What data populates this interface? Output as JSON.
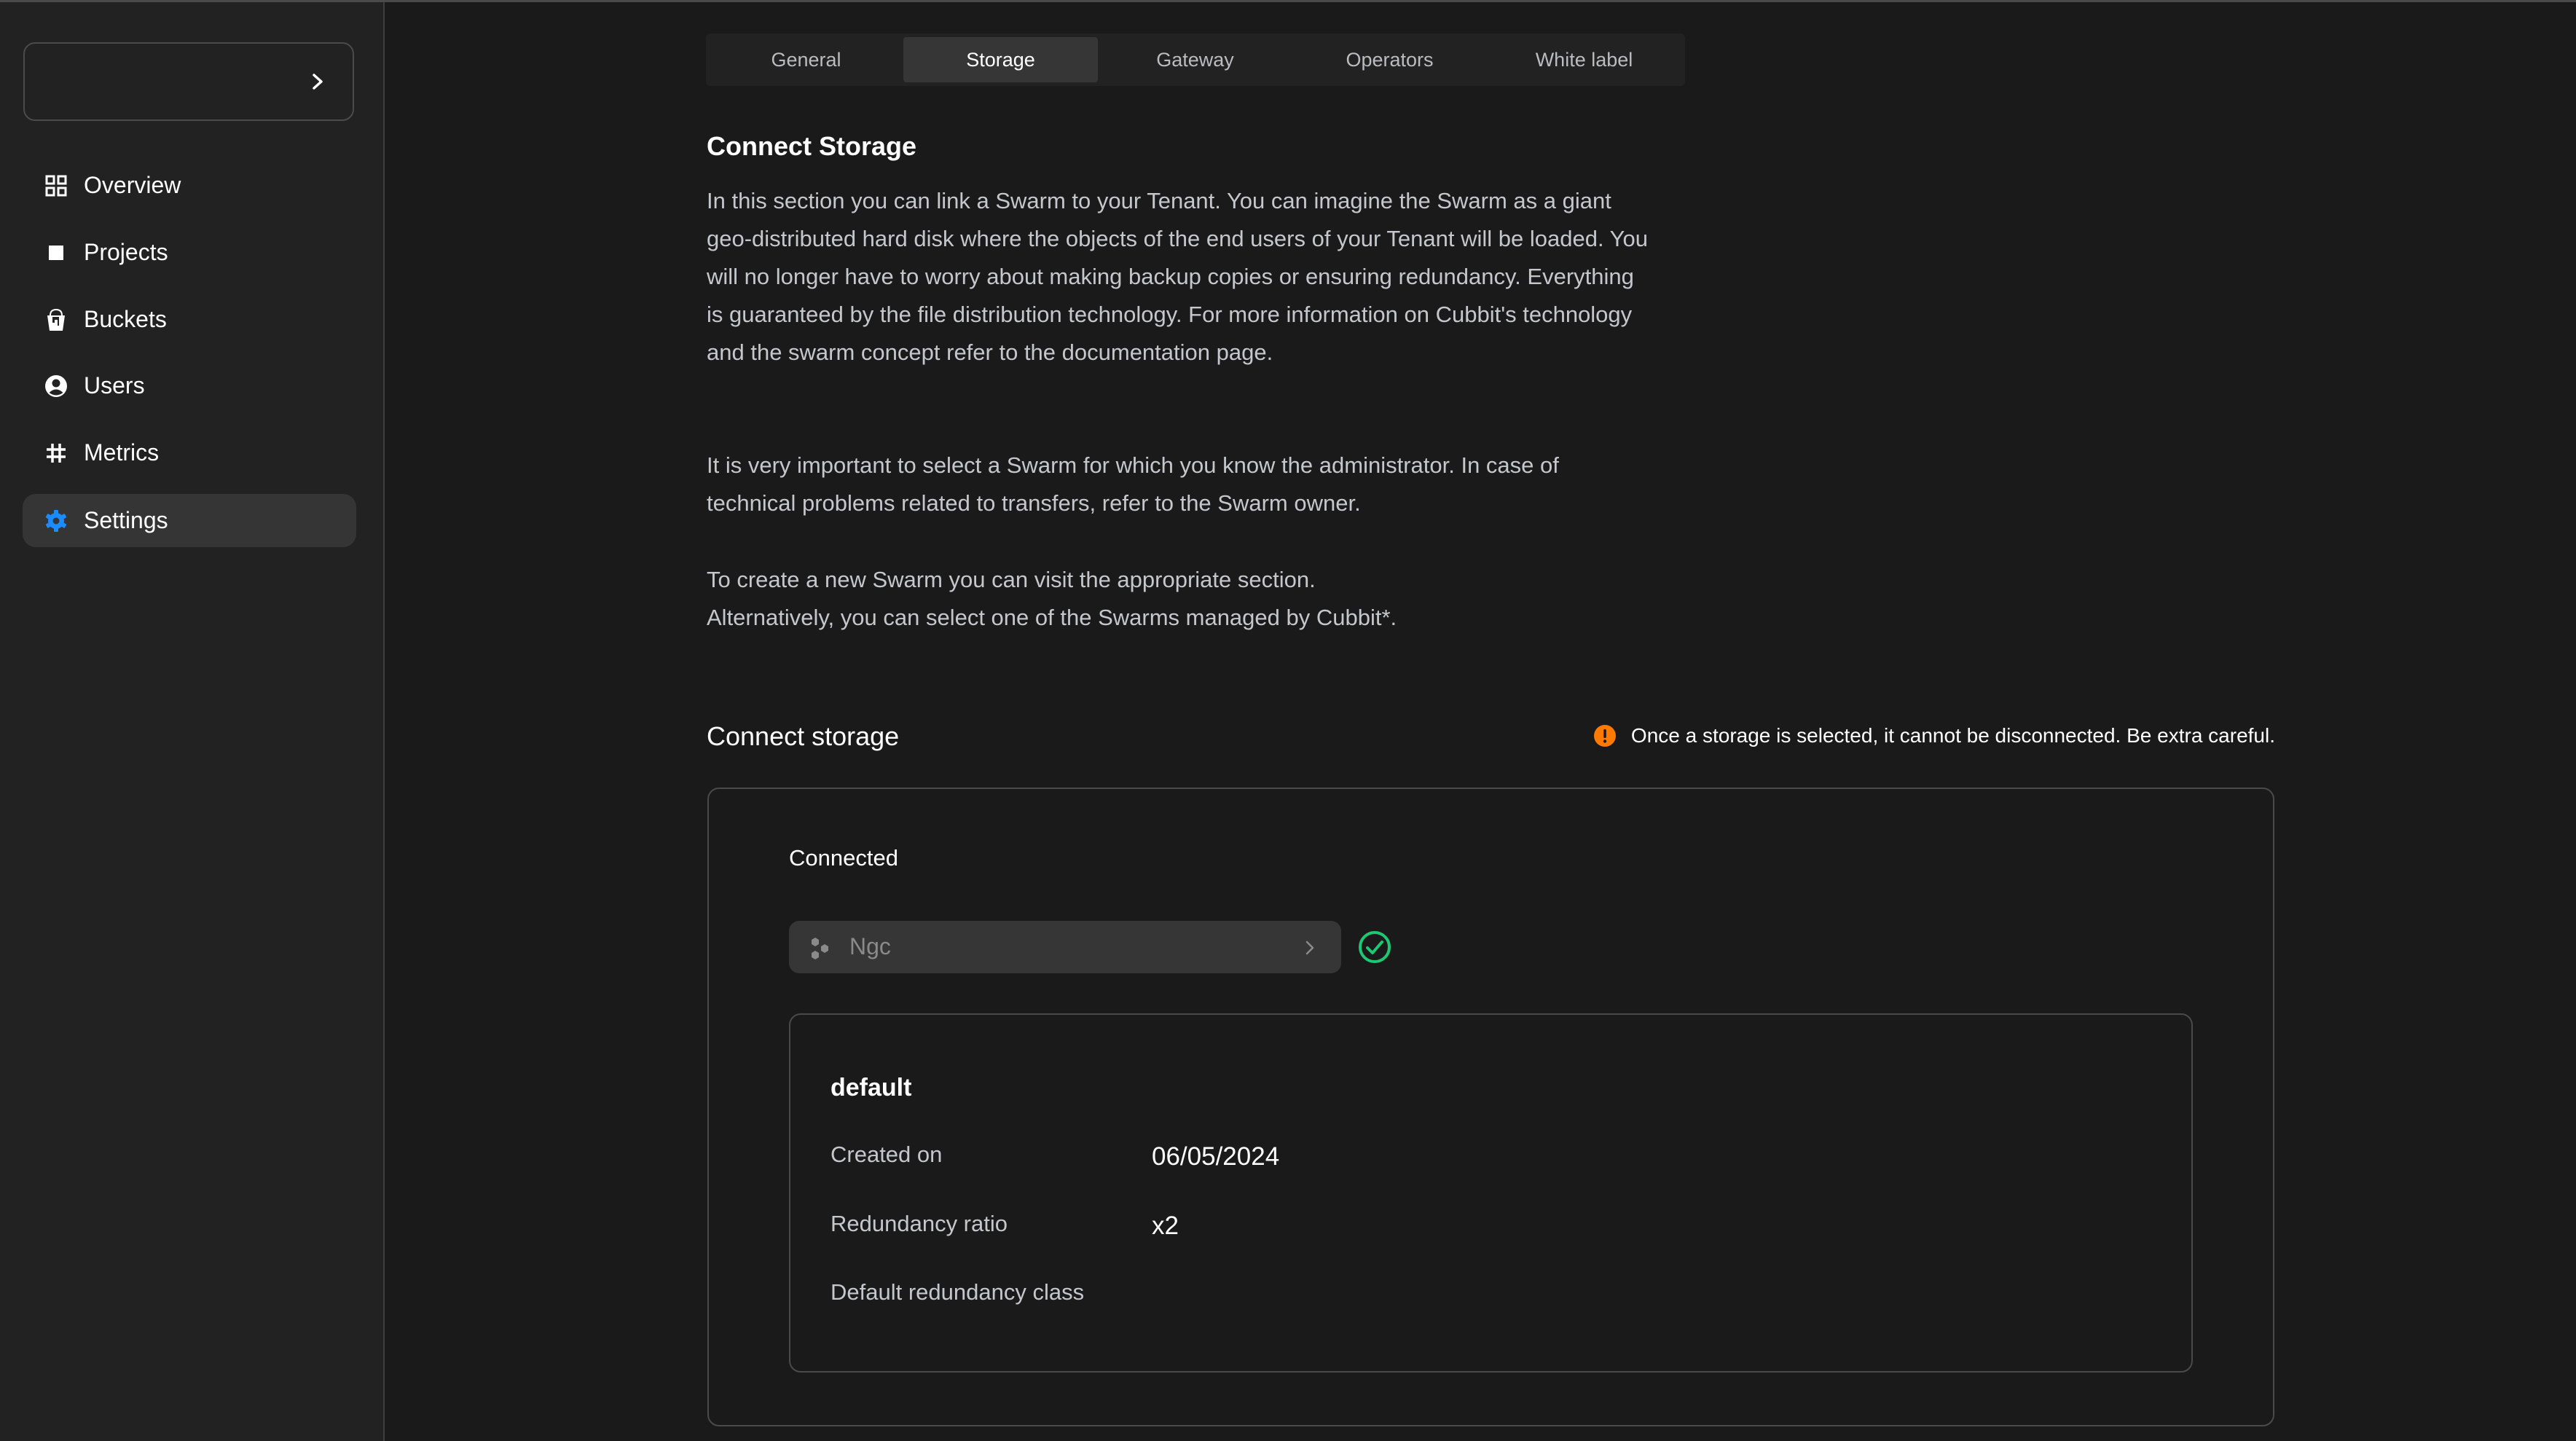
{
  "sidebar": {
    "workspace_selector": {
      "label": ""
    },
    "items": [
      {
        "label": "Overview",
        "icon": "grid-icon",
        "active": false
      },
      {
        "label": "Projects",
        "icon": "square-icon",
        "active": false
      },
      {
        "label": "Buckets",
        "icon": "bucket-icon",
        "active": false
      },
      {
        "label": "Users",
        "icon": "user-circle-icon",
        "active": false
      },
      {
        "label": "Metrics",
        "icon": "hash-icon",
        "active": false
      },
      {
        "label": "Settings",
        "icon": "gear-icon",
        "active": true
      }
    ]
  },
  "tabs": [
    {
      "label": "General",
      "active": false
    },
    {
      "label": "Storage",
      "active": true
    },
    {
      "label": "Gateway",
      "active": false
    },
    {
      "label": "Operators",
      "active": false
    },
    {
      "label": "White label",
      "active": false
    }
  ],
  "intro": {
    "title": "Connect Storage",
    "paragraph1": "In this section you can link a Swarm to your Tenant. You can imagine the Swarm as a giant geo-distributed hard disk where the objects of the end users of your Tenant will be loaded. You will no longer have to worry about making backup copies or ensuring redundancy. Everything is guaranteed by the file distribution technology. For more information on Cubbit's technology and the swarm concept refer to the documentation page.",
    "paragraph2": "It is very important to select a Swarm for which you know the administrator. In case of technical problems related to transfers, refer to the Swarm owner.",
    "paragraph3_line1": "To create a new Swarm you can visit the appropriate section.",
    "paragraph3_line2": "Alternatively, you can select one of the Swarms managed by Cubbit*."
  },
  "connect": {
    "heading": "Connect storage",
    "warning": "Once a storage is selected, it cannot be disconnected. Be extra careful.",
    "status_label": "Connected",
    "swarm_name": "Ngc",
    "pool": {
      "name": "default",
      "rows": [
        {
          "label": "Created on",
          "value": "06/05/2024"
        },
        {
          "label": "Redundancy ratio",
          "value": "x2"
        },
        {
          "label": "Default redundancy class",
          "value": ""
        }
      ]
    }
  },
  "colors": {
    "accent": "#1a8cff",
    "success": "#1ec773",
    "warning": "#ff7a00",
    "background": "#1a1a1a",
    "sidebar": "#222222"
  }
}
